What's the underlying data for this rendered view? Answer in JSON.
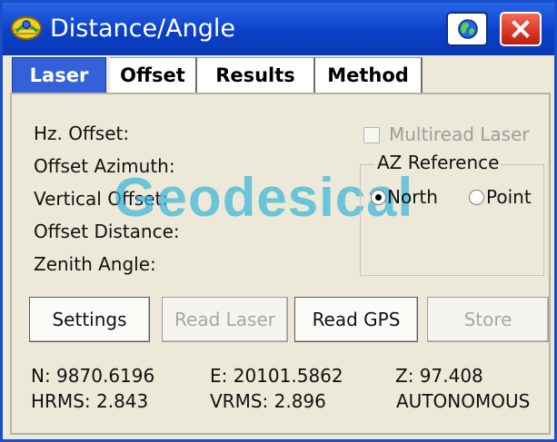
{
  "window": {
    "title": "Distance/Angle",
    "accent_color": "#0a3fc7",
    "close_color": "#d7321f",
    "globe_icon": "globe-icon",
    "close_icon": "close-icon",
    "app_icon": "helmet-icon"
  },
  "tabs": [
    {
      "label": "Laser",
      "active": true
    },
    {
      "label": "Offset",
      "active": false
    },
    {
      "label": "Results",
      "active": false
    },
    {
      "label": "Method",
      "active": false
    }
  ],
  "fields": {
    "hz_offset": "Hz. Offset:",
    "offset_azimuth": "Offset Azimuth:",
    "vertical_offset": "Vertical Offset:",
    "offset_distance": "Offset Distance:",
    "zenith_angle": "Zenith Angle:"
  },
  "watermark": "Geodesical",
  "options": {
    "multiread_laser": {
      "label": "Multiread Laser",
      "checked": false,
      "enabled": false
    },
    "az_reference": {
      "title": "AZ Reference",
      "north_label": "North",
      "point_label": "Point",
      "selected": "North"
    }
  },
  "buttons": {
    "settings": "Settings",
    "read_laser": "Read Laser",
    "read_gps": "Read GPS",
    "store": "Store"
  },
  "status": {
    "n": "N: 9870.6196",
    "e": "E: 20101.5862",
    "z": "Z:  97.408",
    "hrms": "HRMS:  2.843",
    "vrms": "VRMS:  2.896",
    "solution": "AUTONOMOUS"
  }
}
